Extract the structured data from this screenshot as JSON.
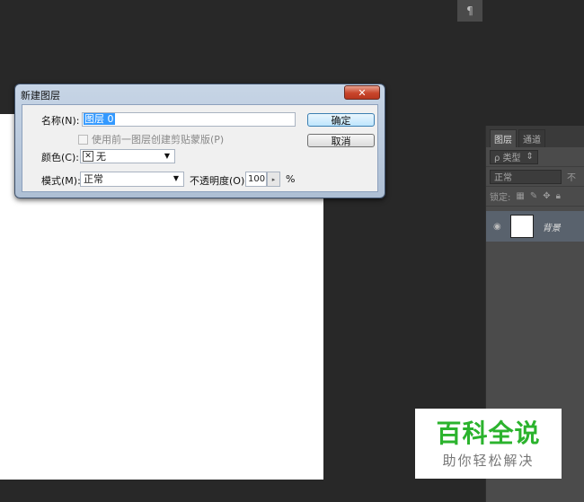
{
  "toolbar": {
    "paragraph_icon": "¶"
  },
  "dialog": {
    "title": "新建图层",
    "close_label": "✕",
    "name_label": "名称(N):",
    "name_value": "图层 0",
    "clip_checkbox_label": "使用前一图层创建剪贴蒙版(P)",
    "color_label": "颜色(C):",
    "color_value": "无",
    "color_x_mark": "✕",
    "mode_label": "模式(M):",
    "mode_value": "正常",
    "opacity_label": "不透明度(O):",
    "opacity_value": "100",
    "opacity_unit": "%",
    "ok_label": "确定",
    "cancel_label": "取消",
    "dropdown_arrow": "▼",
    "stepper_arrow": "▸"
  },
  "layers_panel": {
    "tabs": [
      "图层",
      "通道"
    ],
    "filter_label": "ρ 类型",
    "blend_mode": "正常",
    "opacity_prefix": "不",
    "lock_label": "锁定:",
    "layer_name": "背景",
    "eye_icon": "◉"
  },
  "watermark": {
    "title": "百科全说",
    "subtitle": "助你轻松解决"
  },
  "colors": {
    "background": "#282828",
    "canvas": "#ffffff",
    "dialog_frame": "#aebfd4",
    "close_button": "#c8452b",
    "watermark_green": "#2bb32d",
    "selection": "#3399ff"
  }
}
